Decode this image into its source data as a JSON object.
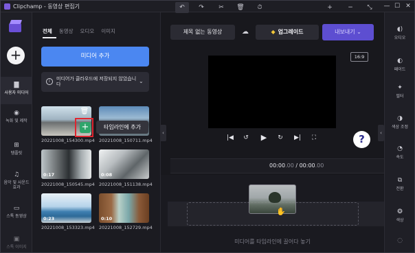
{
  "window": {
    "title": "Clipchamp - 동영상 편집기",
    "minimize": "—",
    "maximize": "☐",
    "close": "✕"
  },
  "left_rail": {
    "items": [
      {
        "label": "사용자 미디어",
        "icon": "folder-icon",
        "glyph": "▇"
      },
      {
        "label": "녹화 및 제작",
        "icon": "record-icon",
        "glyph": "◉"
      },
      {
        "label": "템플릿",
        "icon": "template-icon",
        "glyph": "⊞"
      },
      {
        "label": "음악 및 사운드 효과",
        "icon": "music-icon",
        "glyph": "♫"
      },
      {
        "label": "스톡 동영상",
        "icon": "stock-video-icon",
        "glyph": "▭"
      },
      {
        "label": "스톡 이미지",
        "icon": "stock-image-icon",
        "glyph": "▣"
      }
    ]
  },
  "media_panel": {
    "tabs": [
      "전체",
      "동영상",
      "오디오",
      "이미지"
    ],
    "add_media_label": "미디어 추가",
    "notice_text": "미디어가 클라우드에 저장되지 않았습니다",
    "items": [
      {
        "filename": "20221008_154300.mp4",
        "duration": ""
      },
      {
        "filename": "20221008_150711.mp4",
        "duration": ""
      },
      {
        "filename": "20221008_150545.mp4",
        "duration": "0:17"
      },
      {
        "filename": "20221008_151138.mp4",
        "duration": "0:08"
      },
      {
        "filename": "20221008_153323.mp4",
        "duration": "0:23"
      },
      {
        "filename": "20221008_152729.mp4",
        "duration": "0:10"
      }
    ],
    "tooltip": "타임라인에 추가"
  },
  "header": {
    "project_name": "제목 없는 동영상",
    "upgrade_label": "업그레이드",
    "export_label": "내보내기 ⌄"
  },
  "preview": {
    "aspect_ratio": "16:9"
  },
  "transport": {
    "skip_back": "|◀",
    "rewind": "↺",
    "play": "▶",
    "forward": "↻",
    "skip_forward": "▶|",
    "fullscreen": "⛶"
  },
  "timeline": {
    "current_time": "00:00",
    "current_ms": ".00",
    "separator": " / ",
    "total_time": "00:00",
    "total_ms": ".00",
    "drop_hint": "미디어를 타임라인에 끌어다 놓기"
  },
  "right_rail": {
    "items": [
      {
        "label": "오디오",
        "icon": "audio-icon",
        "glyph": "◖)"
      },
      {
        "label": "페이드",
        "icon": "fade-icon",
        "glyph": "◐"
      },
      {
        "label": "필터",
        "icon": "filter-icon",
        "glyph": "✦"
      },
      {
        "label": "색상 조정",
        "icon": "color-adjust-icon",
        "glyph": "◑"
      },
      {
        "label": "속도",
        "icon": "speed-icon",
        "glyph": "◔"
      },
      {
        "label": "전환",
        "icon": "transition-icon",
        "glyph": "⧉"
      },
      {
        "label": "색상",
        "icon": "color-icon",
        "glyph": "❂"
      }
    ]
  },
  "colors": {
    "accent_blue": "#4b87f1",
    "export_purple": "#5d4ed1",
    "add_green": "#2fa56b",
    "highlight_red": "#e0252f",
    "gem_yellow": "#f2c73a"
  }
}
